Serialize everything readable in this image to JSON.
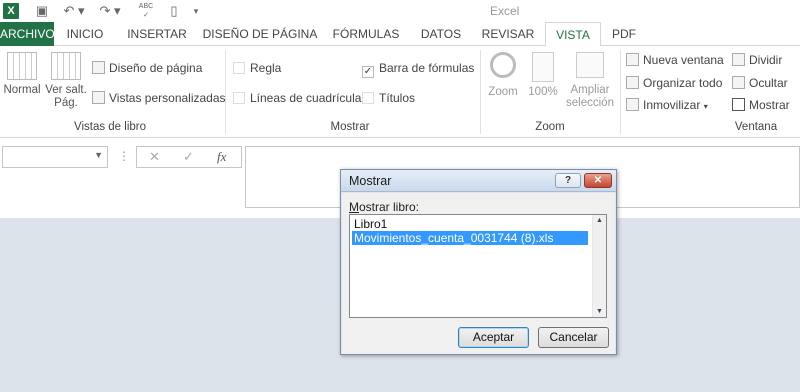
{
  "app": {
    "title": "Excel"
  },
  "quick_access": {
    "save_icon": "save-icon",
    "undo_icon": "undo-icon",
    "redo_icon": "redo-icon",
    "spell_label": "ABC",
    "new_icon": "new-document-icon",
    "customize_icon": "customize-qat-icon"
  },
  "tabs": [
    "ARCHIVO",
    "INICIO",
    "INSERTAR",
    "DISEÑO DE PÁGINA",
    "FÓRMULAS",
    "DATOS",
    "REVISAR",
    "VISTA",
    "PDF"
  ],
  "active_tab": "VISTA",
  "ribbon": {
    "vistas_de_libro": {
      "label": "Vistas de libro",
      "normal": "Normal",
      "ver_salt_1": "Ver salt.",
      "ver_salt_2": "Pág.",
      "diseno": "Diseño de página",
      "personalizadas": "Vistas personalizadas"
    },
    "mostrar": {
      "label": "Mostrar",
      "regla": "Regla",
      "lineas": "Líneas de cuadrícula",
      "barra_formulas": "Barra de fórmulas",
      "titulos": "Títulos",
      "barra_formulas_checked": true
    },
    "zoom": {
      "label": "Zoom",
      "zoom": "Zoom",
      "cien": "100%",
      "ampliar_1": "Ampliar",
      "ampliar_2": "selección"
    },
    "ventana": {
      "label": "Ventana",
      "nueva": "Nueva ventana",
      "organizar": "Organizar todo",
      "inmovilizar": "Inmovilizar",
      "dividir": "Dividir",
      "ocultar": "Ocultar",
      "mostrar": "Mostrar"
    }
  },
  "formula_bar": {
    "name_box_value": "",
    "cancel": "✕",
    "enter": "✓",
    "fx": "fx",
    "formula_value": ""
  },
  "dialog": {
    "title": "Mostrar",
    "help": "?",
    "close": "✕",
    "label_underlined": "M",
    "label_rest": "ostrar libro:",
    "items": [
      "Libro1",
      "Movimientos_cuenta_0031744 (8).xls"
    ],
    "selected_index": 1,
    "accept": "Aceptar",
    "cancel": "Cancelar"
  }
}
